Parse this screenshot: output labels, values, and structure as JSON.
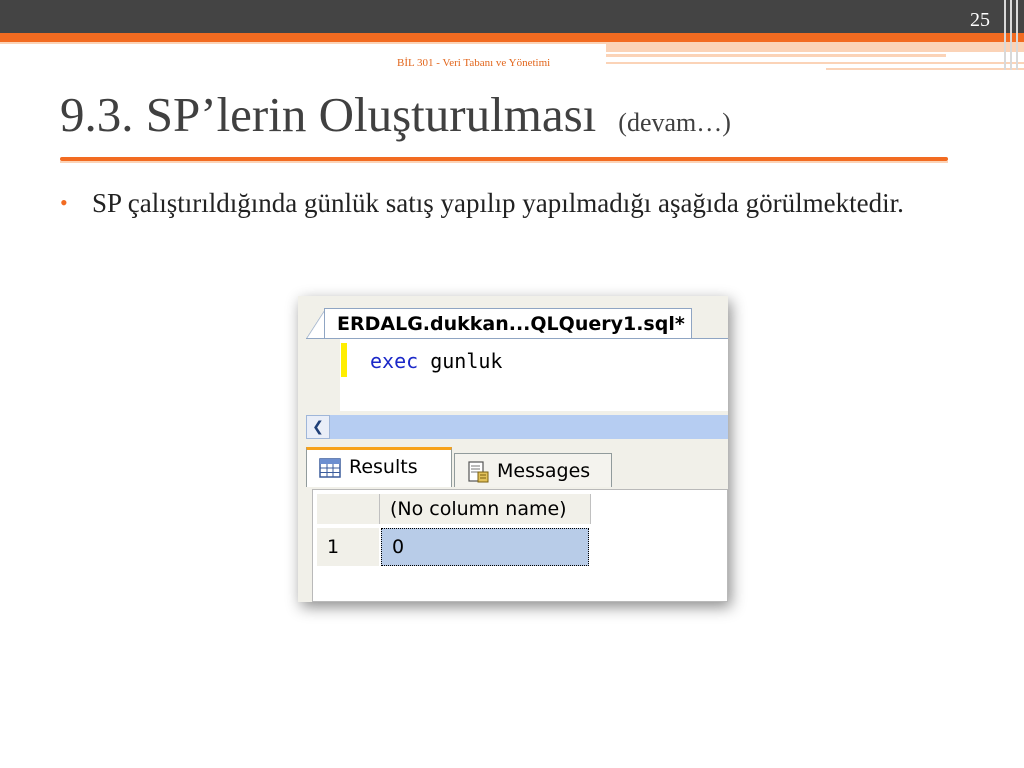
{
  "slide": {
    "page_number": "25",
    "course_header": "BİL 301 - Veri Tabanı ve Yönetimi",
    "title": "9.3. SP’lerin Oluşturulması",
    "title_sub": "(devam…)",
    "bullet": "SP çalıştırıldığında günlük satış yapılıp yapılmadığı aşağıda görülmektedir."
  },
  "screenshot": {
    "tab_title": "ERDALG.dukkan...QLQuery1.sql*",
    "code_keyword": "exec",
    "code_rest": " gunluk",
    "results_tab": "Results",
    "messages_tab": "Messages",
    "grid": {
      "column_header": "(No column name)",
      "row_number": "1",
      "cell_value": "0"
    }
  },
  "colors": {
    "accent": "#f26b21",
    "accent_light": "#fbd3b7",
    "dark_bar": "#444444",
    "keyword": "#1b28c8",
    "selected_cell": "#b8cce8"
  },
  "icons": {
    "scroll_left": "chevron-left-icon",
    "results": "grid-icon",
    "messages": "document-icon"
  }
}
